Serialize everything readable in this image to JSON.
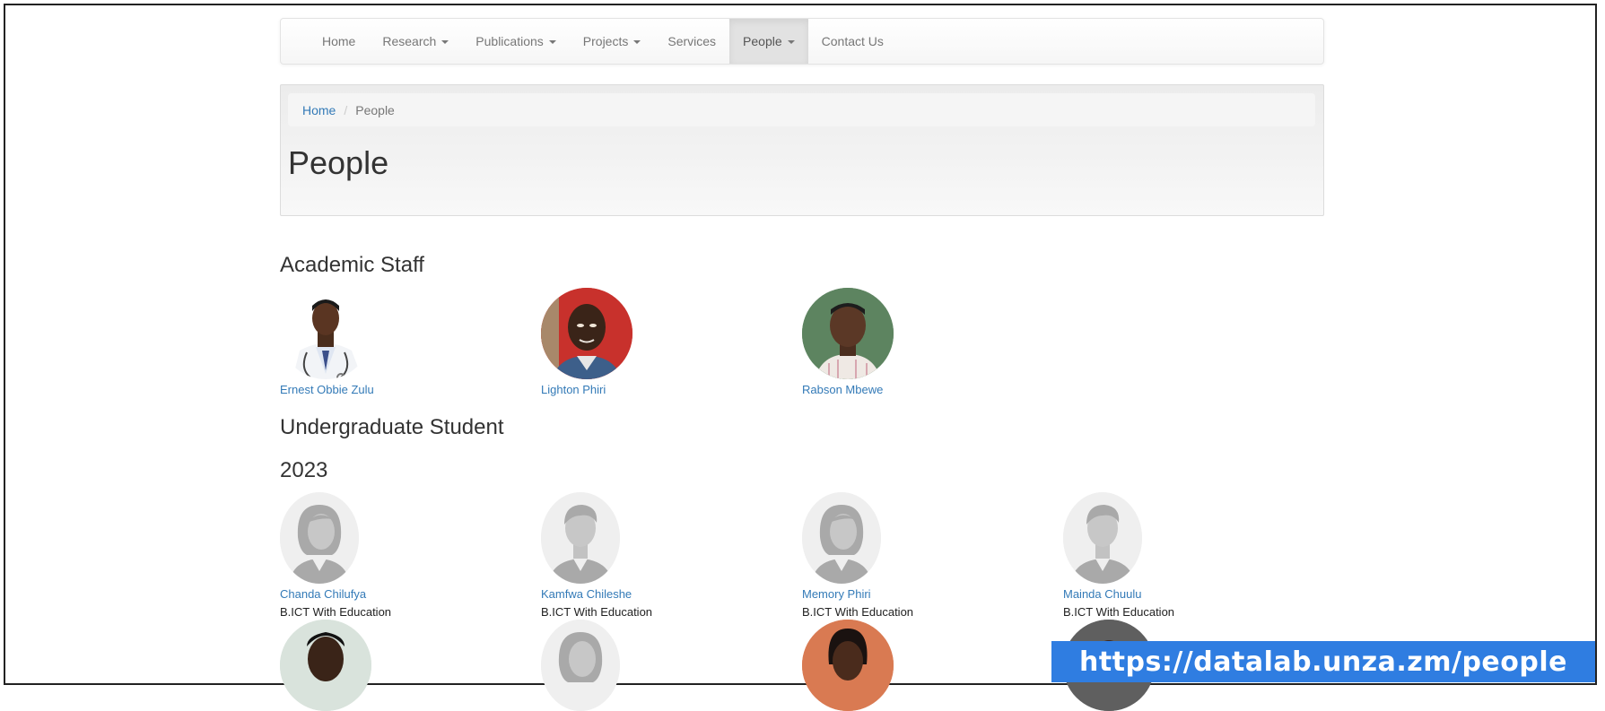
{
  "nav": {
    "items": [
      {
        "label": "Home",
        "dropdown": false,
        "active": false
      },
      {
        "label": "Research",
        "dropdown": true,
        "active": false
      },
      {
        "label": "Publications",
        "dropdown": true,
        "active": false
      },
      {
        "label": "Projects",
        "dropdown": true,
        "active": false
      },
      {
        "label": "Services",
        "dropdown": false,
        "active": false
      },
      {
        "label": "People",
        "dropdown": true,
        "active": true
      },
      {
        "label": "Contact Us",
        "dropdown": false,
        "active": false
      }
    ]
  },
  "breadcrumb": {
    "home": "Home",
    "separator": "/",
    "current": "People"
  },
  "page": {
    "title": "People"
  },
  "sections": {
    "academic_staff": "Academic Staff",
    "undergraduate": "Undergraduate Student",
    "year": "2023"
  },
  "academic_staff": [
    {
      "name": "Ernest Obbie Zulu",
      "avatar": "photo-doctor"
    },
    {
      "name": "Lighton Phiri",
      "avatar": "photo-red-background"
    },
    {
      "name": "Rabson Mbewe",
      "avatar": "photo-green-background"
    }
  ],
  "students_2023": [
    {
      "name": "Chanda Chilufya",
      "program": "B.ICT With Education",
      "avatar": "default-female-icon"
    },
    {
      "name": "Kamfwa Chileshe",
      "program": "B.ICT With Education",
      "avatar": "default-male-icon"
    },
    {
      "name": "Memory Phiri",
      "program": "B.ICT With Education",
      "avatar": "default-female-icon"
    },
    {
      "name": "Mainda Chuulu",
      "program": "B.ICT With Education",
      "avatar": "default-male-icon"
    }
  ],
  "overlay": {
    "url": "https://datalab.unza.zm/people"
  },
  "colors": {
    "link": "#337ab7",
    "banner": "#2f7de1"
  }
}
